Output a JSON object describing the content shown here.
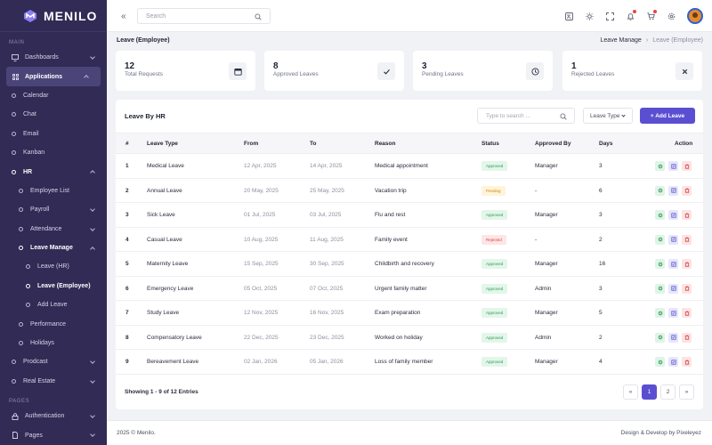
{
  "brand": {
    "name": "MENILO",
    "color": "#5b4fd1"
  },
  "sidebar": {
    "section_main": "MAIN",
    "section_pages": "PAGES",
    "items": [
      {
        "label": "Dashboards",
        "icon": "monitor-icon"
      },
      {
        "label": "Applications",
        "icon": "grid-icon"
      },
      {
        "label": "Calendar"
      },
      {
        "label": "Chat"
      },
      {
        "label": "Email"
      },
      {
        "label": "Kanban"
      },
      {
        "label": "HR"
      },
      {
        "label": "Employee List"
      },
      {
        "label": "Payroll"
      },
      {
        "label": "Attendance"
      },
      {
        "label": "Leave Manage"
      },
      {
        "label": "Leave (HR)"
      },
      {
        "label": "Leave (Employee)"
      },
      {
        "label": "Add Leave"
      },
      {
        "label": "Performance"
      },
      {
        "label": "Holidays"
      },
      {
        "label": "Prodcast"
      },
      {
        "label": "Real Estate"
      }
    ],
    "pages_items": [
      {
        "label": "Authentication",
        "icon": "lock-icon"
      },
      {
        "label": "Pages",
        "icon": "file-icon"
      }
    ]
  },
  "topbar": {
    "search_placeholder": "Search"
  },
  "page": {
    "title": "Leave (Employee)",
    "breadcrumb": [
      "Leave Manage",
      "Leave (Employee)"
    ]
  },
  "stats": [
    {
      "value": "12",
      "label": "Total Requests",
      "icon": "calendar-icon"
    },
    {
      "value": "8",
      "label": "Approved Leaves",
      "icon": "check-icon"
    },
    {
      "value": "3",
      "label": "Pending Leaves",
      "icon": "clock-icon"
    },
    {
      "value": "1",
      "label": "Rejected Leaves",
      "icon": "x-icon"
    }
  ],
  "table": {
    "title": "Leave By HR",
    "search_placeholder": "Type to search ...",
    "filter_label": "Leave Type",
    "add_label": "+ Add Leave",
    "columns": [
      "#",
      "Leave Type",
      "From",
      "To",
      "Reason",
      "Status",
      "Approved By",
      "Days",
      "Action"
    ],
    "rows": [
      {
        "n": "1",
        "type": "Medical Leave",
        "from": "12 Apr, 2025",
        "to": "14 Apr, 2025",
        "reason": "Medical appointment",
        "status": "Approved",
        "by": "Manager",
        "days": "3"
      },
      {
        "n": "2",
        "type": "Annual Leave",
        "from": "20 May, 2025",
        "to": "25 May, 2025",
        "reason": "Vacation trip",
        "status": "Pending",
        "by": "-",
        "days": "6"
      },
      {
        "n": "3",
        "type": "Sick Leave",
        "from": "01 Jul, 2025",
        "to": "03 Jul, 2025",
        "reason": "Flu and rest",
        "status": "Approved",
        "by": "Manager",
        "days": "3"
      },
      {
        "n": "4",
        "type": "Casual Leave",
        "from": "10 Aug, 2025",
        "to": "11 Aug, 2025",
        "reason": "Family event",
        "status": "Rejected",
        "by": "-",
        "days": "2"
      },
      {
        "n": "5",
        "type": "Maternity Leave",
        "from": "15 Sep, 2025",
        "to": "30 Sep, 2025",
        "reason": "Childbirth and recovery",
        "status": "Approved",
        "by": "Manager",
        "days": "16"
      },
      {
        "n": "6",
        "type": "Emergency Leave",
        "from": "05 Oct, 2025",
        "to": "07 Oct, 2025",
        "reason": "Urgent family matter",
        "status": "Approved",
        "by": "Admin",
        "days": "3"
      },
      {
        "n": "7",
        "type": "Study Leave",
        "from": "12 Nov, 2025",
        "to": "16 Nov, 2025",
        "reason": "Exam preparation",
        "status": "Approved",
        "by": "Manager",
        "days": "5"
      },
      {
        "n": "8",
        "type": "Compensatory Leave",
        "from": "22 Dec, 2025",
        "to": "23 Dec, 2025",
        "reason": "Worked on holiday",
        "status": "Approved",
        "by": "Admin",
        "days": "2"
      },
      {
        "n": "9",
        "type": "Bereavement Leave",
        "from": "02 Jan, 2026",
        "to": "05 Jan, 2026",
        "reason": "Loss of family member",
        "status": "Approved",
        "by": "Manager",
        "days": "4"
      }
    ],
    "showing": "Showing 1 - 9 of 12 Entries",
    "pagination": [
      "«",
      "1",
      "2",
      "»"
    ]
  },
  "footer": {
    "copyright": "2025 © Menilo.",
    "credit": "Design & Develop by Pixeleyez"
  }
}
